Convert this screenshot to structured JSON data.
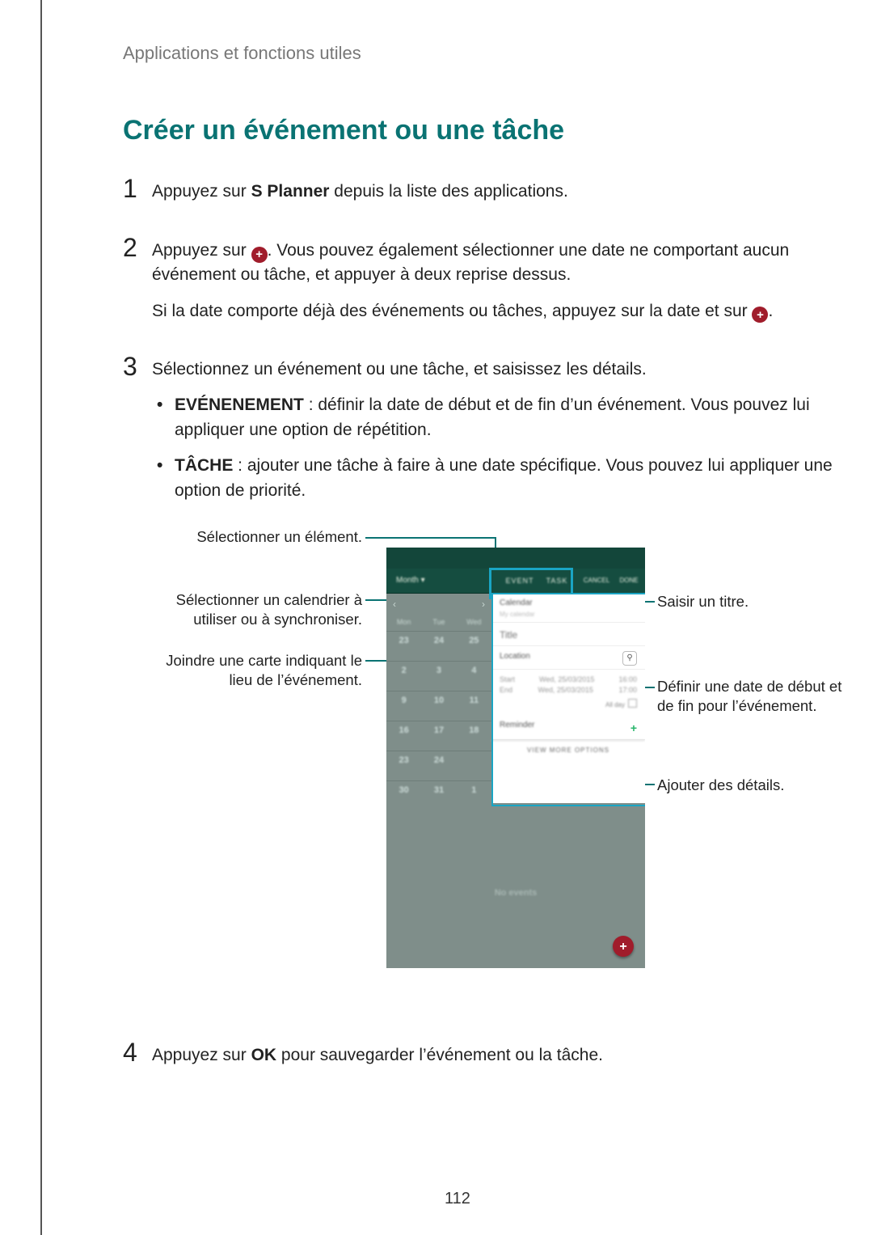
{
  "breadcrumb": "Applications et fonctions utiles",
  "title": "Créer un événement ou une tâche",
  "steps": {
    "s1": {
      "num": "1",
      "a": "Appuyez sur ",
      "b": "S Planner",
      "c": " depuis la liste des applications."
    },
    "s2": {
      "num": "2",
      "p1_a": "Appuyez sur ",
      "p1_b": ". Vous pouvez également sélectionner une date ne comportant aucun événement ou tâche, et appuyer à deux reprise dessus.",
      "p2_a": "Si la date comporte déjà des événements ou tâches, appuyez sur la date et sur ",
      "p2_b": "."
    },
    "s3": {
      "num": "3",
      "p": "Sélectionnez un événement ou une tâche, et saisissez les détails.",
      "bullets": {
        "ev_label": "EVÉNENEMENT",
        "ev_text": " : définir la date de début et de fin d’un événement. Vous pouvez lui appliquer une option de répétition.",
        "ta_label": "TÂCHE",
        "ta_text": " : ajouter une tâche à faire à une date spécifique. Vous pouvez lui appliquer une option de priorité."
      }
    },
    "s4": {
      "num": "4",
      "a": "Appuyez sur ",
      "b": "OK",
      "c": " pour sauvegarder l’événement ou la tâche."
    }
  },
  "callouts": {
    "left1": "Sélectionner un élément.",
    "left2": "Sélectionner un calendrier à utiliser ou à synchroniser.",
    "left3": "Joindre une carte indiquant le lieu de l’événement.",
    "right1": "Saisir un titre.",
    "right2": "Définir une date de début et de fin pour l’événement.",
    "right3": "Ajouter des détails."
  },
  "phone": {
    "month_label": "Month ▾",
    "tab_event": "EVENT",
    "tab_task": "TASK",
    "cancel": "CANCEL",
    "done": "DONE",
    "nav_prev": "‹",
    "nav_next": "›",
    "days": [
      "Mon",
      "Tue",
      "Wed"
    ],
    "rows": [
      [
        "23",
        "24",
        "25"
      ],
      [
        "2",
        "3",
        "4"
      ],
      [
        "9",
        "10",
        "11"
      ],
      [
        "16",
        "17",
        "18"
      ],
      [
        "23",
        "24",
        "●"
      ],
      [
        "30",
        "31",
        "1"
      ]
    ],
    "form": {
      "calendar_label": "Calendar",
      "calendar_value": "My calendar",
      "title_placeholder": "Title",
      "location_label": "Location",
      "start_label": "Start",
      "start_date": "Wed, 25/03/2015",
      "start_time": "16:00",
      "end_label": "End",
      "end_date": "Wed, 25/03/2015",
      "end_time": "17:00",
      "allday": "All day",
      "reminder": "Reminder",
      "more": "VIEW MORE OPTIONS"
    },
    "no_events": "No events",
    "fab": "+"
  },
  "inline_plus": "+",
  "page_number": "112"
}
